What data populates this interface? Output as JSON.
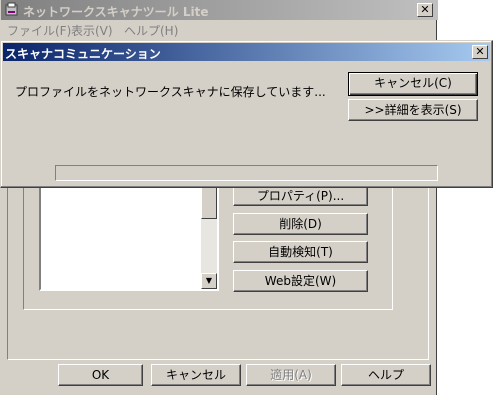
{
  "main_window": {
    "title": "ネットワークスキャナツール Lite",
    "close_glyph": "✕",
    "menu": [
      "ファイル(F)",
      "表示(V)",
      "ヘルプ(H)"
    ],
    "side_buttons": {
      "properties": "プロパティ(P)...",
      "delete": "削除(D)",
      "auto_detect": "自動検知(T)",
      "web_settings": "Web設定(W)"
    },
    "scroll_down_glyph": "▼",
    "footer_buttons": {
      "ok": "OK",
      "cancel": "キャンセル",
      "apply": "適用(A)",
      "help": "ヘルプ"
    }
  },
  "dialog": {
    "title": "スキャナコミュニケーション",
    "close_glyph": "✕",
    "message": "プロファイルをネットワークスキャナに保存しています...",
    "cancel_label": "キャンセル(C)",
    "details_label": ">>詳細を表示(S)",
    "progress": 0
  }
}
